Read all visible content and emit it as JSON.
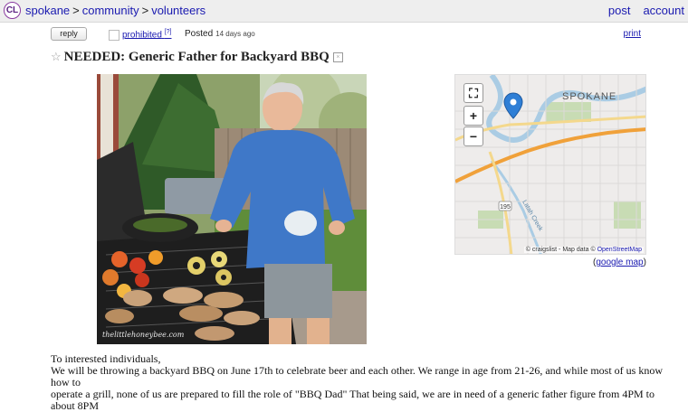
{
  "header": {
    "logo": "CL",
    "breadcrumbs": [
      "spokane",
      "community",
      "volunteers"
    ],
    "links": [
      "post",
      "account"
    ]
  },
  "postbar": {
    "reply_label": "reply",
    "prohibited_label": "prohibited",
    "prohibited_sup": "[?]",
    "posted_label": "Posted",
    "posted_ago": "14 days ago",
    "print_label": "print"
  },
  "title": {
    "star": "☆",
    "text": "NEEDED: Generic Father for Backyard BBQ",
    "hide": "×"
  },
  "photo": {
    "watermark": "thelittlehoneybee.com"
  },
  "map": {
    "city_label": "SPOKANE",
    "attribution_prefix": "© craigslist - Map data ©",
    "attribution_link": "OpenStreetMap",
    "road_label": "Latah Creek",
    "highway_shield": "195",
    "google_map_label": "google map",
    "controls": [
      "⛶",
      "+",
      "−"
    ]
  },
  "body": {
    "line1": "To interested individuals,",
    "line2": "We will be throwing a backyard BBQ on June 17th to celebrate beer and each other. We range in age from 21-26, and while most of us know how to",
    "line3": "operate a grill, none of us are prepared to fill the role of \"BBQ Dad\" That being said, we are in need of a generic father figure from 4PM to about 8PM"
  }
}
